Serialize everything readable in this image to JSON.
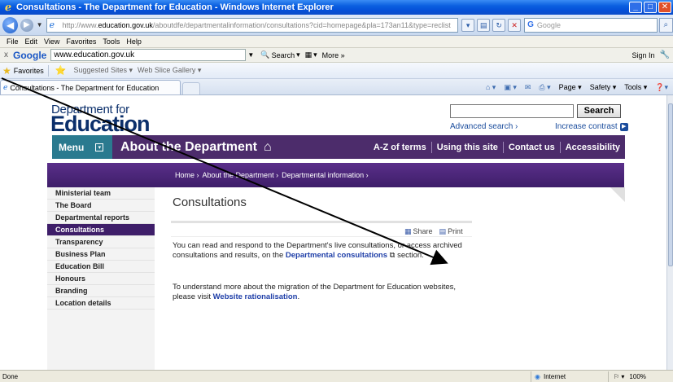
{
  "window": {
    "title": "Consultations - The Department for Education - Windows Internet Explorer"
  },
  "address": {
    "url_prefix": "http://www.",
    "url_domain": "education.gov.uk",
    "url_rest": "/aboutdfe/departmentalinformation/consultations?cid=homepage&pla=173an11&type=reclist",
    "search_placeholder": "Google"
  },
  "menubar": [
    "File",
    "Edit",
    "View",
    "Favorites",
    "Tools",
    "Help"
  ],
  "google_toolbar": {
    "close": "x",
    "logo": "Google",
    "query": "www.education.gov.uk",
    "search_label": "Search",
    "more_label": "More »",
    "sign_in": "Sign In"
  },
  "favorites": {
    "label": "Favorites",
    "suggested": "Suggested Sites ▾",
    "webslice": "Web Slice Gallery ▾"
  },
  "tabs": {
    "active_label": "Consultations - The Department for Education"
  },
  "commandbar": {
    "page": "Page ▾",
    "safety": "Safety ▾",
    "tools": "Tools ▾"
  },
  "site": {
    "logo_line1": "Department for",
    "logo_line2": "Education",
    "search_button": "Search",
    "advanced_search": "Advanced search ›",
    "increase_contrast": "Increase contrast",
    "menu_label": "Menu",
    "section_title": "About the Department",
    "top_links": [
      "A-Z of terms",
      "Using this site",
      "Contact us",
      "Accessibility"
    ],
    "breadcrumbs": [
      "Home ›",
      "About the Department ›",
      "Departmental information ›"
    ]
  },
  "leftnav": [
    "Ministerial team",
    "The Board",
    "Departmental reports",
    "Consultations",
    "Transparency",
    "Business Plan",
    "Education Bill",
    "Honours",
    "Branding",
    "Location details"
  ],
  "content": {
    "heading": "Consultations",
    "share": "Share",
    "print": "Print",
    "para1_a": "You can read and respond to the Department's live consultations, or access archived consultations and results, on the ",
    "para1_link": "Departmental consultations",
    "para1_b": " section.",
    "para2_a": "To understand more about the migration of the Department for Education websites, please visit ",
    "para2_link": "Website rationalisation",
    "para2_b": "."
  },
  "statusbar": {
    "status": "Done",
    "zone": "Internet",
    "zoom": "100%"
  },
  "colors": {
    "purple": "#4c2c6b",
    "teal": "#2a7a8f",
    "link": "#1f3fa8"
  }
}
